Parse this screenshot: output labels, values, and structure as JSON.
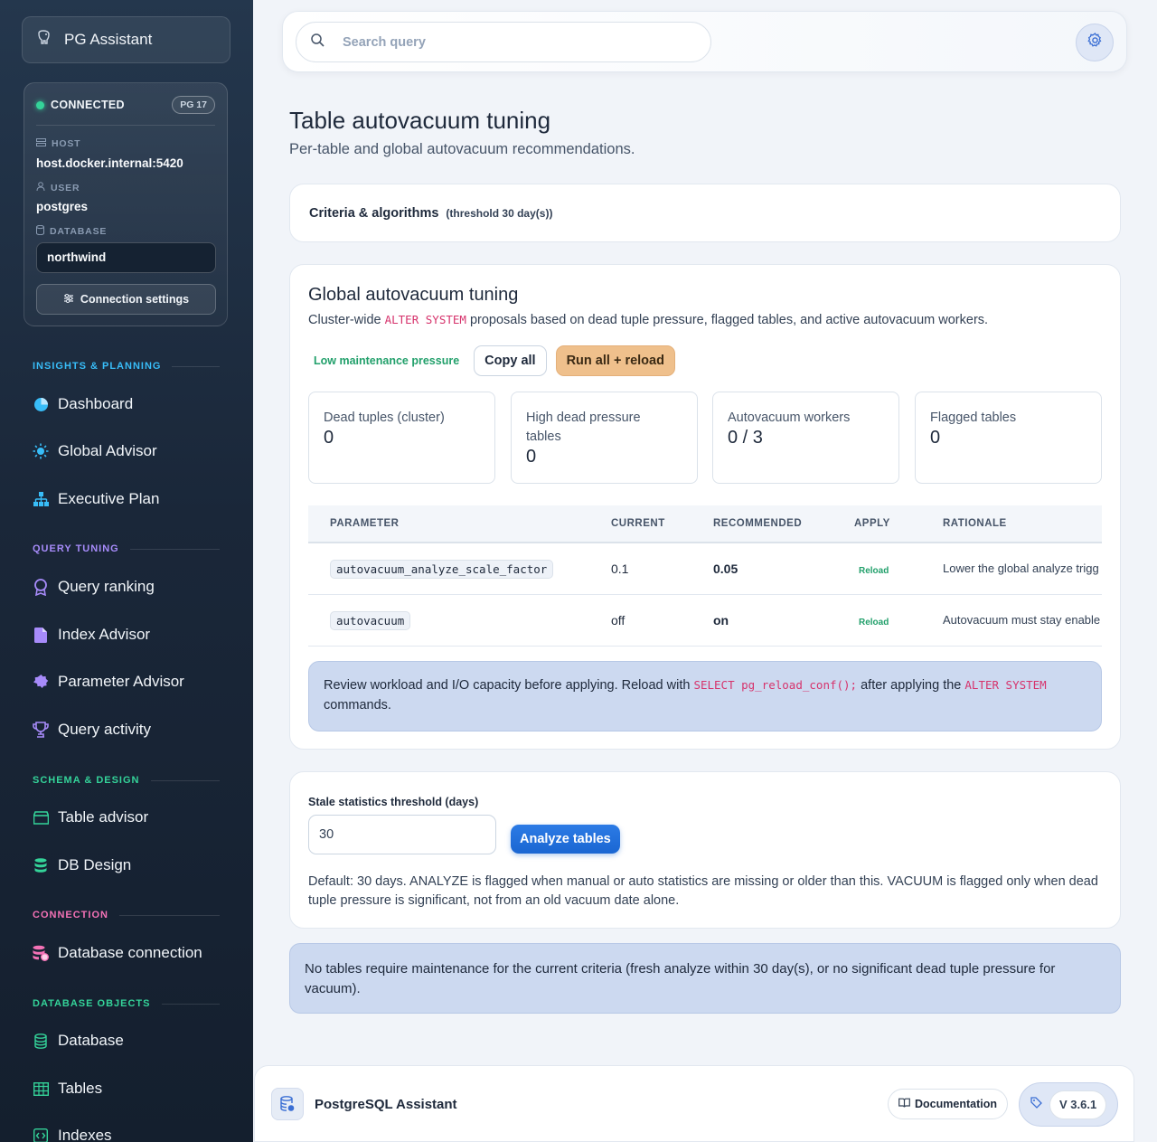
{
  "app": {
    "brand": "PG Assistant"
  },
  "connection": {
    "status": "CONNECTED",
    "pg_version": "PG 17",
    "host_label": "HOST",
    "host": "host.docker.internal:5420",
    "user_label": "USER",
    "user": "postgres",
    "database_label": "DATABASE",
    "database": "northwind",
    "settings_button": "Connection settings"
  },
  "nav": {
    "sections": [
      {
        "title": "INSIGHTS & PLANNING",
        "color": "#38bdf8"
      },
      {
        "title": "QUERY TUNING",
        "color": "#a78bfa"
      },
      {
        "title": "SCHEMA & DESIGN",
        "color": "#34d399"
      },
      {
        "title": "CONNECTION",
        "color": "#f472b6"
      },
      {
        "title": "DATABASE OBJECTS",
        "color": "#34d399"
      }
    ],
    "items": [
      {
        "label": "Dashboard",
        "icon": "pie-chart-icon"
      },
      {
        "label": "Global Advisor",
        "icon": "sun-icon"
      },
      {
        "label": "Executive Plan",
        "icon": "sitemap-icon"
      },
      {
        "label": "Query ranking",
        "icon": "award-icon"
      },
      {
        "label": "Index Advisor",
        "icon": "document-icon"
      },
      {
        "label": "Parameter Advisor",
        "icon": "gear-badge-icon"
      },
      {
        "label": "Query activity",
        "icon": "trophy-icon"
      },
      {
        "label": "Table advisor",
        "icon": "table-drawer-icon"
      },
      {
        "label": "DB Design",
        "icon": "database-stack-icon"
      },
      {
        "label": "Database connection",
        "icon": "database-settings-icon"
      },
      {
        "label": "Database",
        "icon": "database-icon"
      },
      {
        "label": "Tables",
        "icon": "table-grid-icon"
      },
      {
        "label": "Indexes",
        "icon": "code-icon"
      }
    ]
  },
  "search": {
    "placeholder": "Search query"
  },
  "page": {
    "title": "Table autovacuum tuning",
    "subtitle": "Per-table and global autovacuum recommendations."
  },
  "criteria": {
    "title": "Criteria & algorithms",
    "threshold_note": "(threshold 30 day(s))"
  },
  "global": {
    "title": "Global autovacuum tuning",
    "desc_before": "Cluster-wide ",
    "desc_code": "ALTER SYSTEM",
    "desc_after": " proposals based on dead tuple pressure, flagged tables, and active autovacuum workers.",
    "pressure": "Low maintenance pressure",
    "copy_all": "Copy all",
    "run_all": "Run all + reload",
    "stats": [
      {
        "label": "Dead tuples (cluster)",
        "value": "0"
      },
      {
        "label": "High dead pressure tables",
        "value": "0"
      },
      {
        "label": "Autovacuum workers",
        "value": "0 / 3"
      },
      {
        "label": "Flagged tables",
        "value": "0"
      }
    ],
    "table": {
      "headers": [
        "PARAMETER",
        "CURRENT",
        "RECOMMENDED",
        "APPLY",
        "RATIONALE"
      ],
      "rows": [
        {
          "parameter": "autovacuum_analyze_scale_factor",
          "current": "0.1",
          "recommended": "0.05",
          "apply": "Reload",
          "rationale": "Lower the global analyze trigg"
        },
        {
          "parameter": "autovacuum",
          "current": "off",
          "recommended": "on",
          "apply": "Reload",
          "rationale": "Autovacuum must stay enable"
        }
      ]
    },
    "info_before": "Review workload and I/O capacity before applying. Reload with ",
    "info_code1": "SELECT pg_reload_conf();",
    "info_mid": " after applying the ",
    "info_code2": "ALTER SYSTEM",
    "info_after": " commands."
  },
  "stale": {
    "label": "Stale statistics threshold (days)",
    "value": "30",
    "button": "Analyze tables",
    "help": "Default: 30 days. ANALYZE is flagged when manual or auto statistics are missing or older than this. VACUUM is flagged only when dead tuple pressure is significant, not from an old vacuum date alone."
  },
  "notice": "No tables require maintenance for the current criteria (fresh analyze within 30 day(s), or no significant dead tuple pressure for vacuum).",
  "footer": {
    "title": "PostgreSQL Assistant",
    "documentation": "Documentation",
    "version": "V 3.6.1"
  }
}
